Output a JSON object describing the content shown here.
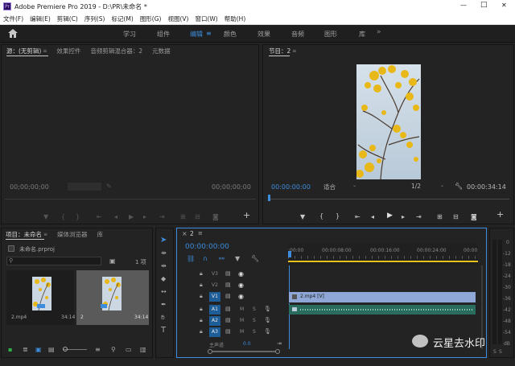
{
  "title_bar": {
    "app_title": "Adobe Premiere Pro 2019 - D:\\PR\\未命名 *",
    "minimize": "—",
    "maximize": "□",
    "close": "✕"
  },
  "menu": [
    "文件(F)",
    "编辑(E)",
    "剪辑(C)",
    "序列(S)",
    "标记(M)",
    "图形(G)",
    "视图(V)",
    "窗口(W)",
    "帮助(H)"
  ],
  "workspaces": {
    "items": [
      "学习",
      "组件",
      "编辑",
      "颜色",
      "效果",
      "音频",
      "图形",
      "库"
    ],
    "active": "编辑",
    "active_menu": "≡"
  },
  "source_panel": {
    "tabs": [
      "源：(无剪辑)",
      "效果控件",
      "音频剪辑混合器：2",
      "元数据"
    ],
    "timecode_left": "00;00;00;00",
    "timecode_right": "00;00;00;00"
  },
  "program_panel": {
    "tab": "节目：2",
    "timecode": "00:00:00:00",
    "fit": "适合",
    "resolution": "1/2",
    "duration": "00:00:34:14"
  },
  "project_panel": {
    "tabs": [
      "项目：未命名",
      "媒体浏览器",
      "库"
    ],
    "project_file": "未命名.prproj",
    "item_count": "1 项",
    "items": [
      {
        "name": "2.mp4",
        "duration": "34:14"
      },
      {
        "name": "2",
        "duration": "34:14"
      }
    ]
  },
  "timeline": {
    "tab_close": "×",
    "sequence": "2",
    "timecode": "00:00:00:00",
    "ruler": [
      ":00:00",
      "00:00:08:00",
      "00:00:16:00",
      "00:00:24:00",
      "00:00"
    ],
    "video_tracks": [
      "V3",
      "V2",
      "V1"
    ],
    "audio_tracks": [
      "A1",
      "A2",
      "A3"
    ],
    "master": "主声道",
    "master_value": "0.0",
    "clip_video": "2.mp4 [V]",
    "mute": "M",
    "solo": "S"
  },
  "meter": {
    "scale": [
      "0",
      "-12",
      "-18",
      "-24",
      "-30",
      "-36",
      "-42",
      "-48",
      "-54",
      "dB"
    ],
    "solo_labels": [
      "S",
      "S"
    ]
  },
  "watermark": "云星去水印",
  "colors": {
    "accent": "#3d8ddc",
    "clip_video": "#8fa7d6",
    "clip_audio": "#2e7d6b",
    "track_active": "#1e5e98"
  }
}
